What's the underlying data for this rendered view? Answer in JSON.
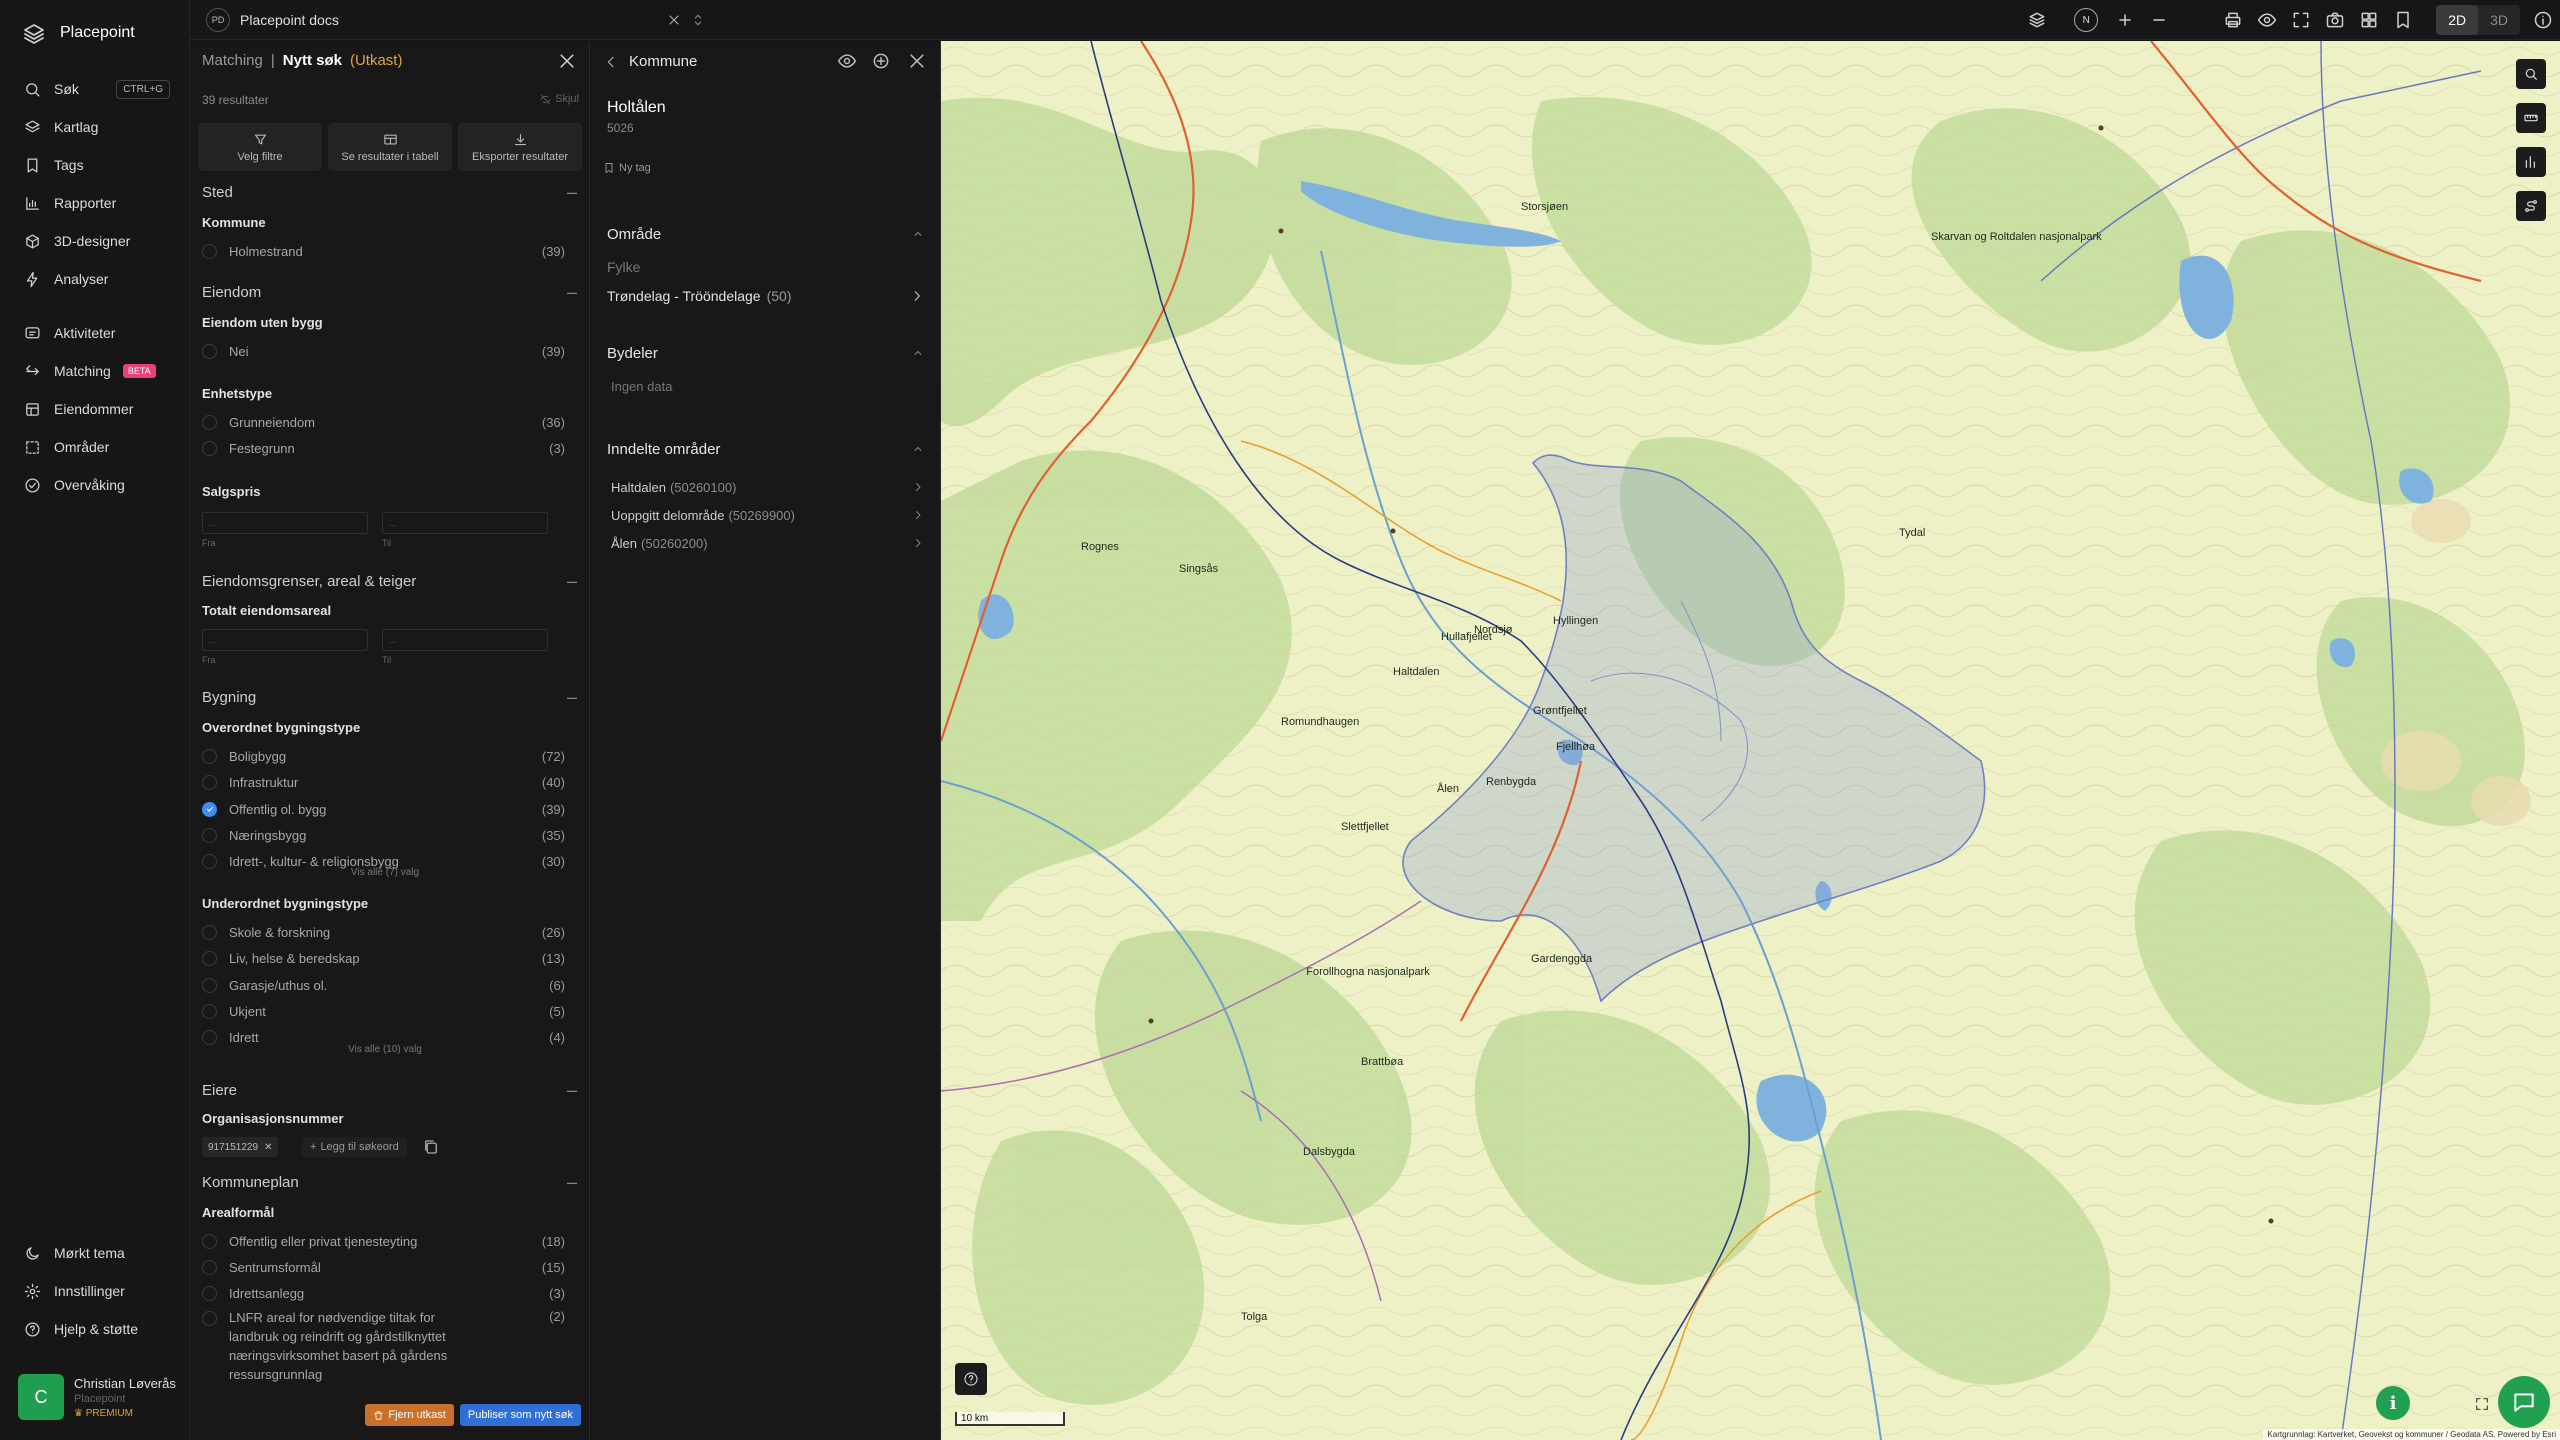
{
  "app": {
    "name": "Placepoint"
  },
  "nav": {
    "main": [
      {
        "label": "Søk",
        "icon": "search-icon",
        "shortcut": "CTRL+G"
      },
      {
        "label": "Kartlag",
        "icon": "layers-icon"
      },
      {
        "label": "Tags",
        "icon": "bookmark-icon"
      },
      {
        "label": "Rapporter",
        "icon": "chart-icon"
      },
      {
        "label": "3D-designer",
        "icon": "cube-icon"
      },
      {
        "label": "Analyser",
        "icon": "bolt-icon"
      }
    ],
    "secondary": [
      {
        "label": "Aktiviteter",
        "icon": "activity-icon"
      },
      {
        "label": "Matching",
        "icon": "matching-icon",
        "badge": "BETA"
      },
      {
        "label": "Eiendommer",
        "icon": "property-icon"
      },
      {
        "label": "Områder",
        "icon": "area-icon"
      },
      {
        "label": "Overvåking",
        "icon": "monitor-icon"
      }
    ],
    "bottom": [
      {
        "label": "Mørkt tema",
        "icon": "moon-icon"
      },
      {
        "label": "Innstillinger",
        "icon": "gear-icon"
      },
      {
        "label": "Hjelp & støtte",
        "icon": "help-icon"
      }
    ]
  },
  "user": {
    "initial": "C",
    "name": "Christian Løverås",
    "org": "Placepoint",
    "plan": "PREMIUM"
  },
  "topbar": {
    "doc_initials": "PD",
    "doc_name": "Placepoint docs",
    "compass": "N",
    "mode_2d": "2D",
    "mode_3d": "3D"
  },
  "search": {
    "crumb": "Matching",
    "title": "Nytt søk",
    "status": "(Utkast)",
    "result_count": "39 resultater",
    "hide": "Skjul",
    "actions": [
      {
        "label": "Velg filtre",
        "icon": "filter-icon"
      },
      {
        "label": "Se resultater i tabell",
        "icon": "table-icon"
      },
      {
        "label": "Eksporter resultater",
        "icon": "download-icon"
      }
    ],
    "sted": {
      "title": "Sted",
      "kommune_label": "Kommune",
      "options": [
        {
          "label": "Holmestrand",
          "count": "(39)"
        }
      ]
    },
    "eiendom": {
      "title": "Eiendom",
      "uten_bygg_label": "Eiendom uten bygg",
      "uten_bygg": [
        {
          "label": "Nei",
          "count": "(39)"
        }
      ],
      "enhetstype_label": "Enhetstype",
      "enhetstype": [
        {
          "label": "Grunneiendom",
          "count": "(36)"
        },
        {
          "label": "Festegrunn",
          "count": "(3)"
        }
      ],
      "salgspris_label": "Salgspris",
      "from": "Fra",
      "to": "Til",
      "min_placeholder": "...",
      "max_placeholder": "..."
    },
    "grenser": {
      "title": "Eiendomsgrenser, areal & teiger",
      "areal_label": "Totalt eiendomsareal"
    },
    "bygning": {
      "title": "Bygning",
      "overordnet_label": "Overordnet bygningstype",
      "overordnet": [
        {
          "label": "Boligbygg",
          "count": "(72)",
          "checked": false
        },
        {
          "label": "Infrastruktur",
          "count": "(40)",
          "checked": false
        },
        {
          "label": "Offentlig ol. bygg",
          "count": "(39)",
          "checked": true
        },
        {
          "label": "Næringsbygg",
          "count": "(35)",
          "checked": false
        },
        {
          "label": "Idrett-, kultur- & religionsbygg",
          "count": "(30)",
          "checked": false
        }
      ],
      "overordnet_more": "Vis alle (7) valg",
      "underordnet_label": "Underordnet bygningstype",
      "underordnet": [
        {
          "label": "Skole & forskning",
          "count": "(26)"
        },
        {
          "label": "Liv, helse & beredskap",
          "count": "(13)"
        },
        {
          "label": "Garasje/uthus ol.",
          "count": "(6)"
        },
        {
          "label": "Ukjent",
          "count": "(5)"
        },
        {
          "label": "Idrett",
          "count": "(4)"
        }
      ],
      "underordnet_more": "Vis alle (10) valg"
    },
    "eiere": {
      "title": "Eiere",
      "org_label": "Organisasjonsnummer",
      "chip": "917151229",
      "add": "Legg til søkeord"
    },
    "kommuneplan": {
      "title": "Kommuneplan",
      "areal_label": "Arealformål",
      "options": [
        {
          "label": "Offentlig eller privat tjenesteyting",
          "count": "(18)"
        },
        {
          "label": "Sentrumsformål",
          "count": "(15)"
        },
        {
          "label": "Idrettsanlegg",
          "count": "(3)"
        },
        {
          "label": "LNFR areal for nødvendige tiltak for landbruk og reindrift og gårdstilknyttet næringsvirksomhet basert på gårdens ressursgrunnlag",
          "count": "(2)"
        }
      ]
    },
    "footer": {
      "delete": "Fjern utkast",
      "publish": "Publiser som nytt søk"
    }
  },
  "detail": {
    "header": "Kommune",
    "name": "Holtålen",
    "code": "5026",
    "tag": "Ny tag",
    "omrade": {
      "title": "Område",
      "fylke_label": "Fylke",
      "fylke_name": "Trøndelag - Trööndelage",
      "fylke_count": "(50)"
    },
    "bydeler": {
      "title": "Bydeler",
      "empty": "Ingen data"
    },
    "inndelte": {
      "title": "Inndelte områder",
      "items": [
        {
          "name": "Haltdalen",
          "code": "(50260100)"
        },
        {
          "name": "Uoppgitt delområde",
          "code": "(50269900)"
        },
        {
          "name": "Ålen",
          "code": "(50260200)"
        }
      ]
    }
  },
  "map": {
    "scale": "10 km",
    "attribution": "Kartgrunnlag: Kartverket, Geovekst og kommuner / Geodata AS. Powered by Esri",
    "labels": [
      "Haltdalen",
      "Ålen",
      "Renbygda",
      "Hyllingen",
      "Gardenggda",
      "Brattbøa",
      "Storsjøen",
      "Singsås",
      "Rognes",
      "Fjellhøa",
      "Grøntfjellet",
      "Tydal",
      "Forollhogna nasjonalpark",
      "Skarvan og Roltdalen nasjonalpark",
      "Nordsjø",
      "Hullafjellet",
      "Romundhaugen",
      "Slettfjellet",
      "Dalsbygda",
      "Tolga"
    ],
    "colors": {
      "land": "#eef0c6",
      "forest": "#c7dea0",
      "water": "#7fb3dd",
      "selection": "#8f9fd4"
    }
  }
}
